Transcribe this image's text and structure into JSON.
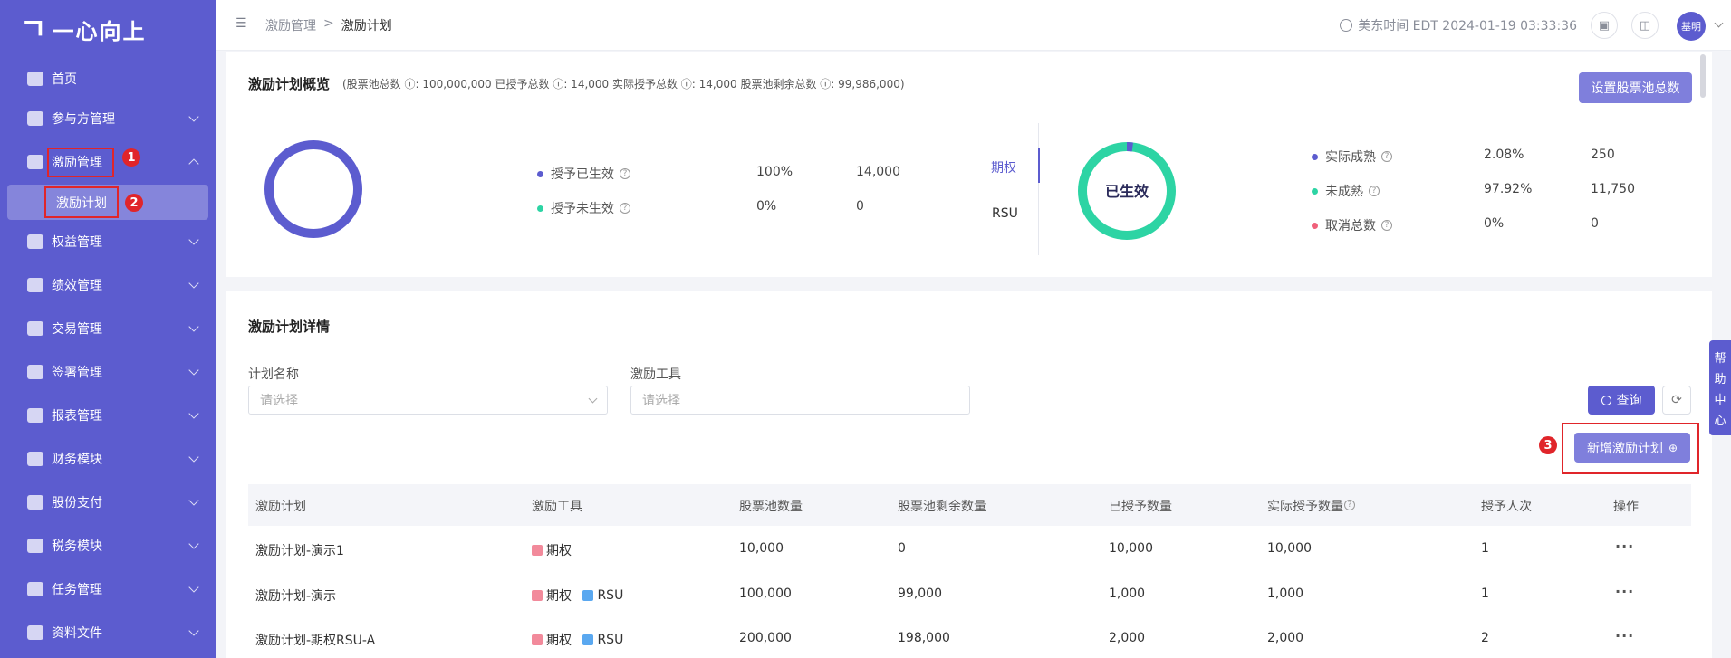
{
  "brand": {
    "logo_mark": "ㄱ",
    "name": "一心向上"
  },
  "sidebar": {
    "items": [
      {
        "label": "首页"
      },
      {
        "label": "参与方管理"
      },
      {
        "label": "激励管理"
      },
      {
        "label": "权益管理"
      },
      {
        "label": "绩效管理"
      },
      {
        "label": "交易管理"
      },
      {
        "label": "签署管理"
      },
      {
        "label": "报表管理"
      },
      {
        "label": "财务模块"
      },
      {
        "label": "股份支付"
      },
      {
        "label": "税务模块"
      },
      {
        "label": "任务管理"
      },
      {
        "label": "资料文件"
      }
    ],
    "sub_active": "激励计划"
  },
  "annotations": {
    "n1": "1",
    "n2": "2",
    "n3": "3"
  },
  "header": {
    "breadcrumb": [
      "激励管理",
      ">",
      "激励计划"
    ],
    "time": "美东时间 EDT 2024-01-19 03:33:36",
    "avatar": "基明"
  },
  "overview": {
    "title": "激励计划概览",
    "stats_text": "(股票池总数 ⓘ: 100,000,000   已授予总数 ⓘ: 14,000   实际授予总数 ⓘ: 14,000   股票池剩余总数 ⓘ: 99,986,000)",
    "set_pool_button": "设置股票池总数",
    "grant_legend": [
      {
        "label": "授予已生效",
        "pct": "100%",
        "value": "14,000",
        "color": "#5c5ccf"
      },
      {
        "label": "授予未生效",
        "pct": "0%",
        "value": "0",
        "color": "#2dd4a4"
      }
    ],
    "tabs": [
      "期权",
      "RSU"
    ],
    "donut_center": "已生效",
    "vest_legend": [
      {
        "label": "实际成熟",
        "pct": "2.08%",
        "value": "250",
        "color": "#5c5ccf"
      },
      {
        "label": "未成熟",
        "pct": "97.92%",
        "value": "11,750",
        "color": "#2dd4a4"
      },
      {
        "label": "取消总数",
        "pct": "0%",
        "value": "0",
        "color": "#f0607a"
      }
    ],
    "donut_right_fraction": 0.0208
  },
  "detail": {
    "title": "激励计划详情",
    "plan_name_label": "计划名称",
    "plan_name_placeholder": "请选择",
    "tool_label": "激励工具",
    "tool_placeholder": "请选择",
    "query_button": "查询",
    "reset_icon": "⟳",
    "add_button": "新增激励计划",
    "columns": [
      "激励计划",
      "激励工具",
      "股票池数量",
      "股票池剩余数量",
      "已授予数量",
      "实际授予数量",
      "授予人次",
      "操作"
    ],
    "rows": [
      {
        "name": "激励计划-演示1",
        "tools": [
          "期权"
        ],
        "pool": "10,000",
        "remaining": "0",
        "granted": "10,000",
        "actual": "10,000",
        "count": "1",
        "op": "···"
      },
      {
        "name": "激励计划-演示",
        "tools": [
          "期权",
          "RSU"
        ],
        "pool": "100,000",
        "remaining": "99,000",
        "granted": "1,000",
        "actual": "1,000",
        "count": "1",
        "op": "···"
      },
      {
        "name": "激励计划-期权RSU-A",
        "tools": [
          "期权",
          "RSU"
        ],
        "pool": "200,000",
        "remaining": "198,000",
        "granted": "2,000",
        "actual": "2,000",
        "count": "2",
        "op": "···"
      }
    ]
  },
  "help_tab": [
    "帮",
    "助",
    "中",
    "心"
  ],
  "colors": {
    "primary": "#5c5ccf",
    "green": "#2dd4a4",
    "red": "#f0607a",
    "annotation": "#e0252a"
  }
}
